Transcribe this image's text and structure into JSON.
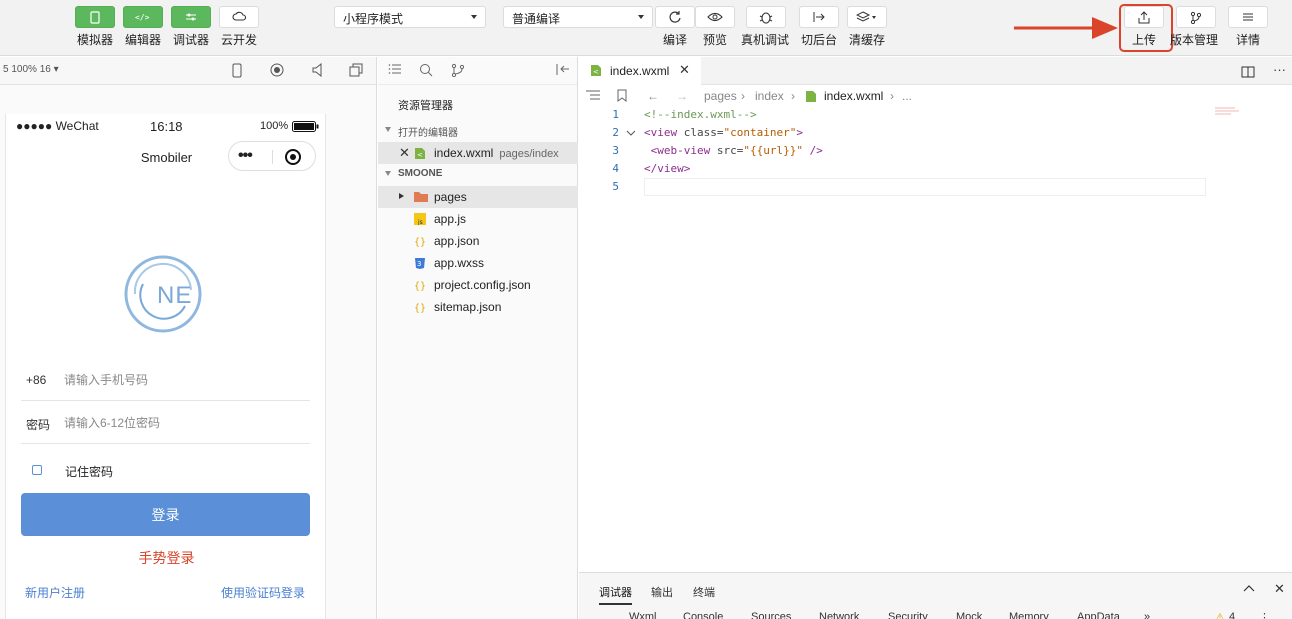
{
  "toolbar": {
    "simulator": "模拟器",
    "editor": "编辑器",
    "debugger": "调试器",
    "cloud": "云开发",
    "mode_select": "小程序模式",
    "compile_select": "普通编译",
    "compile": "编译",
    "preview": "预览",
    "device_debug": "真机调试",
    "background": "切后台",
    "clear_cache": "清缓存",
    "upload": "上传",
    "version": "版本管理",
    "details": "详情"
  },
  "simulator": {
    "zoom_label": "5 100% 16 ▾",
    "carrier": "●●●●● WeChat",
    "time": "16:18",
    "battery": "100%",
    "nav_title": "Smobiler",
    "phone_prefix": "+86",
    "phone_placeholder": "请输入手机号码",
    "password_label": "密码",
    "password_placeholder": "请输入6-12位密码",
    "remember": "记住密码",
    "login": "登录",
    "gesture_login": "手势登录",
    "register": "新用户注册",
    "code_login": "使用验证码登录",
    "colors": {
      "primary": "#5b8fd8",
      "danger": "#d9442a"
    }
  },
  "explorer": {
    "title": "资源管理器",
    "open_editors": "打开的编辑器",
    "open_file": "index.wxml",
    "open_file_path": "pages/index",
    "project": "SMOONE",
    "files": [
      "pages",
      "app.js",
      "app.json",
      "app.wxss",
      "project.config.json",
      "sitemap.json"
    ]
  },
  "editor": {
    "tab_name": "index.wxml",
    "breadcrumb": [
      "pages",
      "index",
      "index.wxml",
      "..."
    ],
    "lines": [
      {
        "n": "1",
        "parts": [
          {
            "t": "<!--index.wxml-->",
            "c": "c-comment"
          }
        ]
      },
      {
        "n": "2",
        "parts": [
          {
            "t": "<view ",
            "c": "c-tag"
          },
          {
            "t": "class=",
            "c": "c-attr"
          },
          {
            "t": "\"container\"",
            "c": "c-str"
          },
          {
            "t": ">",
            "c": "c-tag"
          }
        ]
      },
      {
        "n": "3",
        "parts": [
          {
            "t": " <web-view ",
            "c": "c-tag"
          },
          {
            "t": "src=",
            "c": "c-attr"
          },
          {
            "t": "\"{{url}}\"",
            "c": "c-str"
          },
          {
            "t": " />",
            "c": "c-tag"
          }
        ]
      },
      {
        "n": "4",
        "parts": [
          {
            "t": "</view>",
            "c": "c-tag"
          }
        ]
      },
      {
        "n": "5",
        "parts": []
      }
    ]
  },
  "debug": {
    "tabs": [
      "调试器",
      "输出",
      "终端"
    ],
    "subtabs": [
      "Wxml",
      "Console",
      "Sources",
      "Network",
      "Security",
      "Mock",
      "Memory",
      "AppData",
      "»"
    ],
    "warning_count": "4"
  }
}
